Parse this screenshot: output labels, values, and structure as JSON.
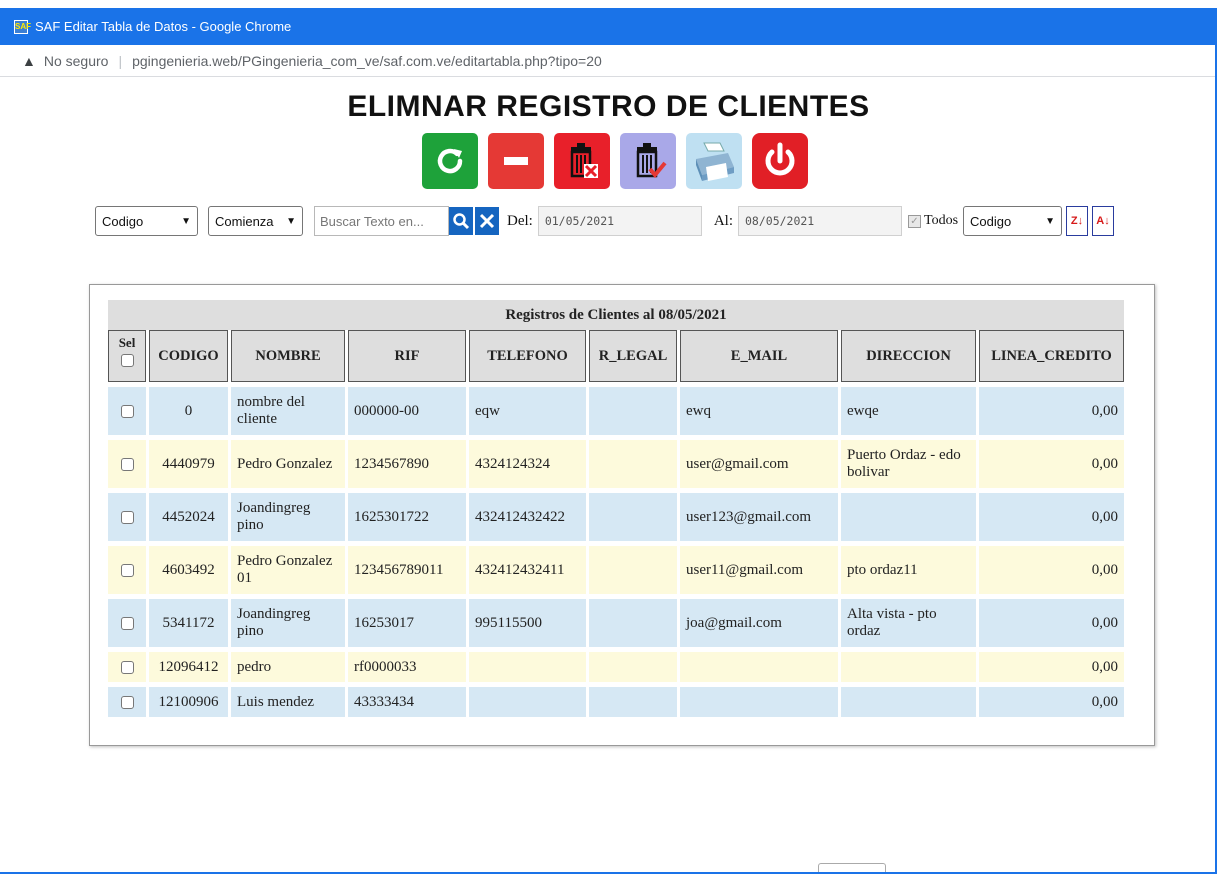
{
  "window": {
    "title": "SAF Editar Tabla de Datos - Google Chrome",
    "app_icon_text": "SAF"
  },
  "address_bar": {
    "security_label": "No seguro",
    "url": "pgingenieria.web/PGingenieria_com_ve/saf.com.ve/editartabla.php?tipo=20"
  },
  "page": {
    "title": "ELIMNAR REGISTRO DE CLIENTES"
  },
  "toolbar": {
    "icons": [
      "refresh-icon",
      "remove-icon",
      "delete-selected-icon",
      "delete-all-icon",
      "print-icon",
      "power-icon"
    ]
  },
  "filters": {
    "field_select": "Codigo",
    "match_select": "Comienza",
    "search_placeholder": "Buscar Texto en...",
    "del_label": "Del:",
    "del_value": "01/05/2021",
    "al_label": "Al:",
    "al_value": "08/05/2021",
    "todos_label": "Todos",
    "sort_select": "Codigo"
  },
  "table": {
    "caption": "Registros de Clientes al 08/05/2021",
    "headers": {
      "sel": "Sel",
      "codigo": "CODIGO",
      "nombre": "NOMBRE",
      "rif": "RIF",
      "telefono": "TELEFONO",
      "r_legal": "R_LEGAL",
      "e_mail": "E_MAIL",
      "direccion": "DIRECCION",
      "linea_credito": "LINEA_CREDITO"
    },
    "rows": [
      {
        "codigo": "0",
        "nombre": "nombre del cliente",
        "rif": "000000-00",
        "telefono": "eqw",
        "r_legal": "",
        "e_mail": "ewq",
        "direccion": "ewqe",
        "linea_credito": "0,00"
      },
      {
        "codigo": "4440979",
        "nombre": "Pedro Gonzalez",
        "rif": "1234567890",
        "telefono": "4324124324",
        "r_legal": "",
        "e_mail": "user@gmail.com",
        "direccion": "Puerto Ordaz - edo bolivar",
        "linea_credito": "0,00"
      },
      {
        "codigo": "4452024",
        "nombre": "Joandingreg pino",
        "rif": "1625301722",
        "telefono": "432412432422",
        "r_legal": "",
        "e_mail": "user123@gmail.com",
        "direccion": "",
        "linea_credito": "0,00"
      },
      {
        "codigo": "4603492",
        "nombre": "Pedro Gonzalez 01",
        "rif": "123456789011",
        "telefono": "432412432411",
        "r_legal": "",
        "e_mail": "user11@gmail.com",
        "direccion": "pto ordaz11",
        "linea_credito": "0,00"
      },
      {
        "codigo": "5341172",
        "nombre": "Joandingreg pino",
        "rif": "16253017",
        "telefono": "995115500",
        "r_legal": "",
        "e_mail": "joa@gmail.com",
        "direccion": "Alta vista - pto ordaz",
        "linea_credito": "0,00"
      },
      {
        "codigo": "12096412",
        "nombre": "pedro",
        "rif": "rf0000033",
        "telefono": "",
        "r_legal": "",
        "e_mail": "",
        "direccion": "",
        "linea_credito": "0,00"
      },
      {
        "codigo": "12100906",
        "nombre": "Luis mendez",
        "rif": "43333434",
        "telefono": "",
        "r_legal": "",
        "e_mail": "",
        "direccion": "",
        "linea_credito": "0,00"
      }
    ]
  },
  "colors": {
    "chrome_blue": "#1a73e8",
    "row_blue": "#d6e8f4",
    "row_yellow": "#fdfadc",
    "header_gray": "#dedede"
  }
}
